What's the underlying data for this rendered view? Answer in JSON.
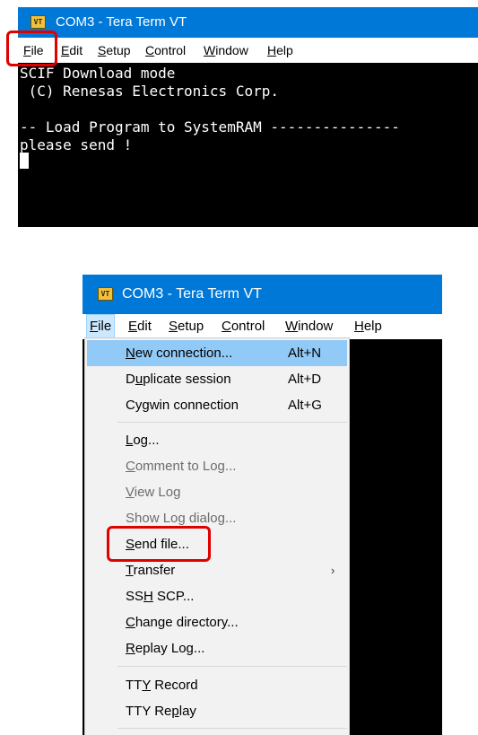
{
  "window1": {
    "icon": "VT",
    "title": "COM3 - Tera Term VT",
    "menu": [
      {
        "key": "file",
        "mnemonic": "F",
        "rest": "ile"
      },
      {
        "key": "edit",
        "mnemonic": "E",
        "rest": "dit"
      },
      {
        "key": "setup",
        "mnemonic": "S",
        "rest": "etup"
      },
      {
        "key": "control",
        "mnemonic": "C",
        "rest": "ontrol"
      },
      {
        "key": "window",
        "mnemonic": "W",
        "rest": "indow"
      },
      {
        "key": "help",
        "mnemonic": "H",
        "rest": "elp"
      }
    ],
    "terminal_lines": [
      "SCIF Download mode",
      " (C) Renesas Electronics Corp.",
      "",
      "-- Load Program to SystemRAM ---------------",
      "please send !"
    ]
  },
  "window2": {
    "icon": "VT",
    "title": "COM3 - Tera Term VT",
    "menu": [
      {
        "key": "file",
        "mnemonic": "F",
        "rest": "ile"
      },
      {
        "key": "edit",
        "mnemonic": "E",
        "rest": "dit"
      },
      {
        "key": "setup",
        "mnemonic": "S",
        "rest": "etup"
      },
      {
        "key": "control",
        "mnemonic": "C",
        "rest": "ontrol"
      },
      {
        "key": "window",
        "mnemonic": "W",
        "rest": "indow"
      },
      {
        "key": "help",
        "mnemonic": "H",
        "rest": "elp"
      }
    ],
    "file_menu": [
      {
        "key": "new-connection",
        "pre": "",
        "mnemonic": "N",
        "post": "ew connection...",
        "shortcut": "Alt+N",
        "state": "hover"
      },
      {
        "key": "duplicate-session",
        "pre": "D",
        "mnemonic": "u",
        "post": "plicate session",
        "shortcut": "Alt+D"
      },
      {
        "key": "cygwin-connection",
        "pre": "Cy",
        "mnemonic": "g",
        "post": "win connection",
        "shortcut": "Alt+G"
      },
      {
        "key": "log",
        "pre": "",
        "mnemonic": "L",
        "post": "og..."
      },
      {
        "key": "comment-to-log",
        "pre": "",
        "mnemonic": "C",
        "post": "omment to Log...",
        "state": "disabled"
      },
      {
        "key": "view-log",
        "pre": "",
        "mnemonic": "V",
        "post": "iew Log",
        "state": "disabled"
      },
      {
        "key": "show-log-dialog",
        "pre": "Show Lo",
        "mnemonic": "g",
        "post": " dialog...",
        "state": "disabled"
      },
      {
        "key": "send-file",
        "pre": "",
        "mnemonic": "S",
        "post": "end file..."
      },
      {
        "key": "transfer",
        "pre": "",
        "mnemonic": "T",
        "post": "ransfer",
        "submenu": "›"
      },
      {
        "key": "ssh-scp",
        "pre": "SS",
        "mnemonic": "H",
        "post": " SCP..."
      },
      {
        "key": "change-directory",
        "pre": "",
        "mnemonic": "C",
        "post": "hange directory..."
      },
      {
        "key": "replay-log",
        "pre": "",
        "mnemonic": "R",
        "post": "eplay Log..."
      },
      {
        "key": "tty-record",
        "pre": "TT",
        "mnemonic": "Y",
        "post": " Record"
      },
      {
        "key": "tty-replay",
        "pre": "TTY Re",
        "mnemonic": "p",
        "post": "lay"
      }
    ]
  },
  "colors": {
    "titlebar": "#0078d7",
    "terminal_bg": "#000000",
    "terminal_fg": "#ffffff",
    "menu_hover": "#91c9f7",
    "highlight": "#e00000"
  }
}
